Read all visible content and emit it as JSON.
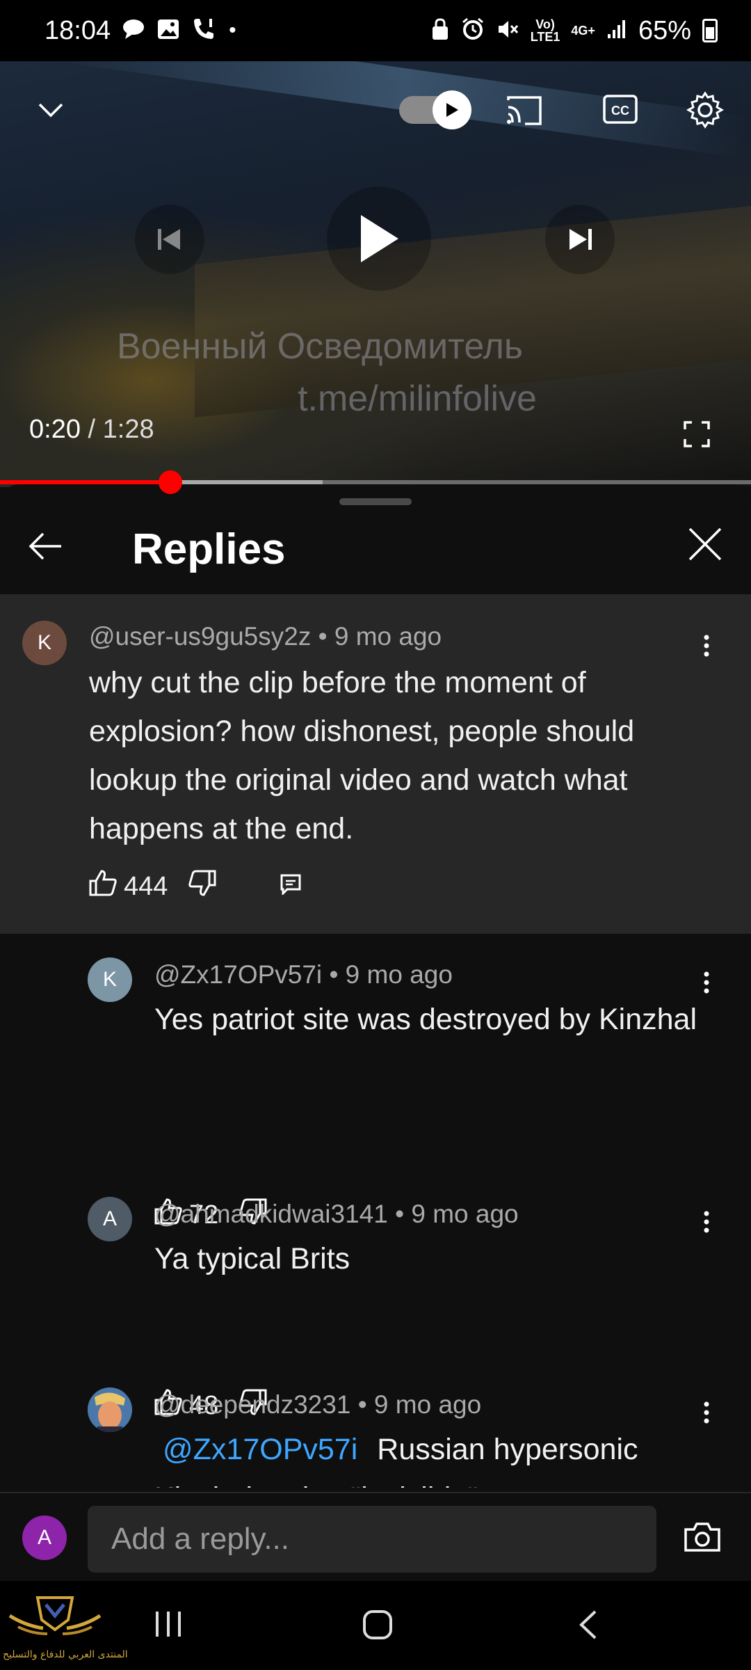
{
  "status_bar": {
    "time": "18:04",
    "battery": "65%",
    "network_top": "Vo)",
    "network_bottom": "LTE1",
    "data_type": "4G+"
  },
  "player": {
    "watermark_line1": "Военный Осведомитель",
    "watermark_line2": "t.me/milinfolive",
    "current_time": "0:20",
    "separator": " / ",
    "duration": "1:28",
    "progress_fraction": 0.227,
    "buffered_fraction": 0.43,
    "cc_label": "CC"
  },
  "panel": {
    "title": "Replies"
  },
  "parent_comment": {
    "avatar_letter": "K",
    "avatar_color": "#6d4a3e",
    "author": "@user-us9gu5sy2z",
    "age": "• 9 mo ago",
    "text": "why cut the clip before the moment of explosion? how dishonest, people should lookup the original video and watch what happens at the end.",
    "likes": "444"
  },
  "replies": [
    {
      "avatar_letter": "K",
      "avatar_color": "#7d96a6",
      "author": "@Zx17OPv57i",
      "age": "• 9 mo ago",
      "text": "Yes patriot site was destroyed by Kinzhal",
      "likes": "72"
    },
    {
      "avatar_letter": "A",
      "avatar_color": "#4f5b66",
      "author": "@ahmadkidwai3141",
      "age": "• 9 mo ago",
      "text": "Ya typical Brits",
      "likes": "48"
    },
    {
      "author": "@deependz3231",
      "age": "• 9 mo ago",
      "mention": "@Zx17OPv57i",
      "text": "Russian hypersonic",
      "text_cutoff": "Kinzhal ...t i...t \"invisible\" ..."
    }
  ],
  "reply_bar": {
    "avatar_letter": "A",
    "avatar_color": "#8e24aa",
    "placeholder": "Add a reply..."
  },
  "watermark_logo": {
    "text": "المنتدى العربي للدفاع والتسليح"
  }
}
